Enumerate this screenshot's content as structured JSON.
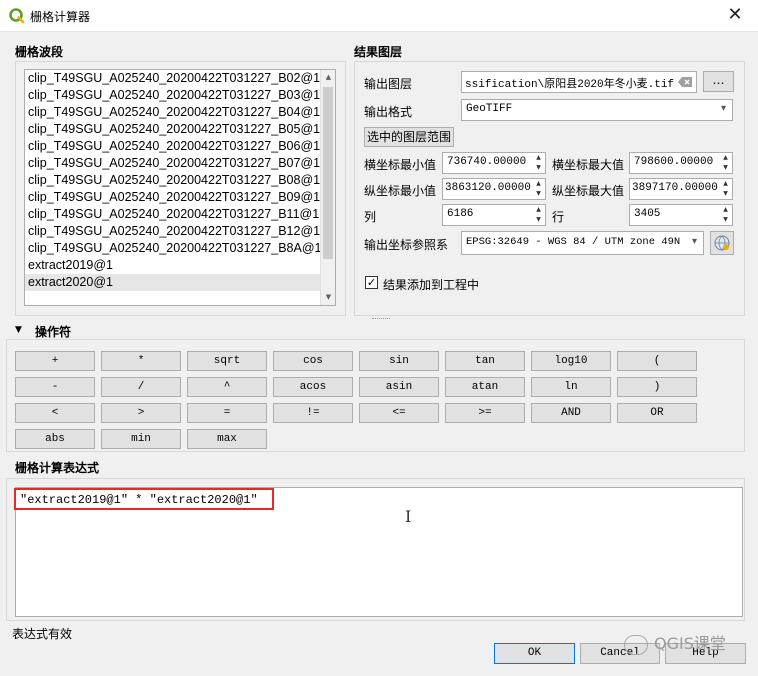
{
  "window": {
    "title": "栅格计算器",
    "close_glyph": "✕",
    "logo_icon": "qgis-logo-icon"
  },
  "bands": {
    "title": "栅格波段",
    "items": [
      "clip_T49SGU_A025240_20200422T031227_B02@1",
      "clip_T49SGU_A025240_20200422T031227_B03@1",
      "clip_T49SGU_A025240_20200422T031227_B04@1",
      "clip_T49SGU_A025240_20200422T031227_B05@1",
      "clip_T49SGU_A025240_20200422T031227_B06@1",
      "clip_T49SGU_A025240_20200422T031227_B07@1",
      "clip_T49SGU_A025240_20200422T031227_B08@1",
      "clip_T49SGU_A025240_20200422T031227_B09@1",
      "clip_T49SGU_A025240_20200422T031227_B11@1",
      "clip_T49SGU_A025240_20200422T031227_B12@1",
      "clip_T49SGU_A025240_20200422T031227_B8A@1",
      "extract2019@1",
      "extract2020@1"
    ],
    "selected_item": "extract2020@1"
  },
  "result": {
    "title": "结果图层",
    "output_layer_label": "输出图层",
    "output_layer_value": "ssification\\原阳县2020年冬小麦.tif",
    "browse_label": "…",
    "output_format_label": "输出格式",
    "output_format_value": "GeoTIFF",
    "extent_button_label": "选中的图层范围",
    "xmin_label": "横坐标最小值",
    "xmin_value": "736740.00000",
    "xmax_label": "横坐标最大值",
    "xmax_value": "798600.00000",
    "ymin_label": "纵坐标最小值",
    "ymin_value": "3863120.00000",
    "ymax_label": "纵坐标最大值",
    "ymax_value": "3897170.00000",
    "cols_label": "列",
    "cols_value": "6186",
    "rows_label": "行",
    "rows_value": "3405",
    "crs_label": "输出坐标参照系",
    "crs_value": "EPSG:32649 - WGS 84 / UTM zone 49N",
    "add_to_project_label": "结果添加到工程中",
    "add_to_project_checked": true
  },
  "operators": {
    "title": "操作符",
    "buttons": [
      "+",
      "*",
      "sqrt",
      "cos",
      "sin",
      "tan",
      "log10",
      "(",
      "-",
      "/",
      "^",
      "acos",
      "asin",
      "atan",
      "ln",
      ")",
      "<",
      ">",
      "=",
      "!=",
      "<=",
      ">=",
      "AND",
      "OR",
      "abs",
      "min",
      "max"
    ]
  },
  "expression": {
    "title": "栅格计算表达式",
    "value": "\"extract2019@1\" * \"extract2020@1\"",
    "status": "表达式有效"
  },
  "footer": {
    "ok_label": "OK",
    "cancel_label": "Cancel",
    "help_label": "Help"
  },
  "watermark": {
    "text": "QGIS课堂"
  },
  "colors": {
    "highlight_box": "#e8282a",
    "selected_row": "#e6e6e6"
  }
}
